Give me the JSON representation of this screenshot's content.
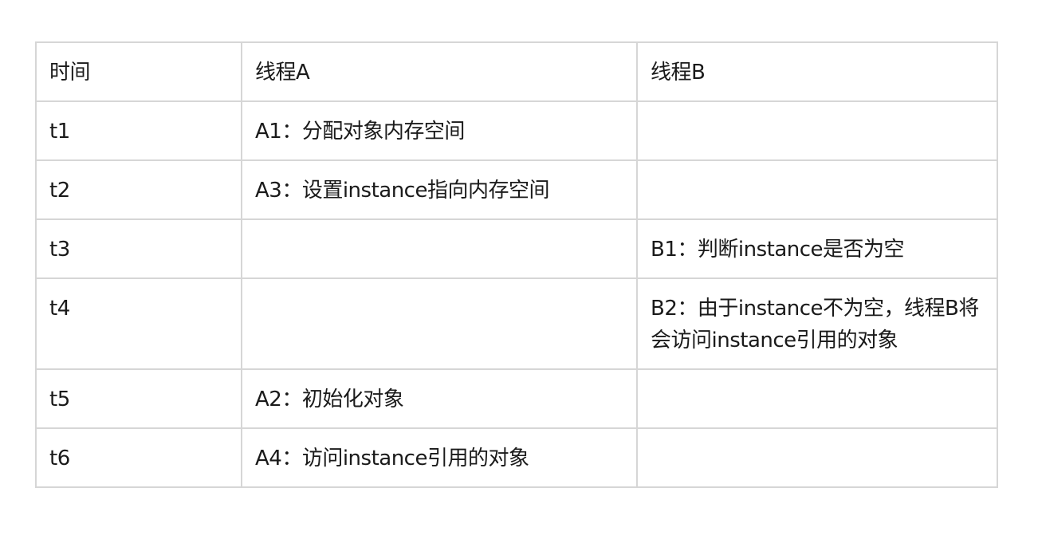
{
  "table": {
    "headers": [
      "时间",
      "线程A",
      "线程B"
    ],
    "rows": [
      {
        "time": "t1",
        "thread_a": "A1：分配对象内存空间",
        "thread_b": ""
      },
      {
        "time": "t2",
        "thread_a": "A3：设置instance指向内存空间",
        "thread_b": ""
      },
      {
        "time": "t3",
        "thread_a": "",
        "thread_b": "B1：判断instance是否为空"
      },
      {
        "time": "t4",
        "thread_a": "",
        "thread_b": "B2：由于instance不为空，线程B将会访问instance引用的对象"
      },
      {
        "time": "t5",
        "thread_a": "A2：初始化对象",
        "thread_b": ""
      },
      {
        "time": "t6",
        "thread_a": "A4：访问instance引用的对象",
        "thread_b": ""
      }
    ]
  },
  "colors": {
    "border": "#d6d6d6",
    "text": "#1a1a1a",
    "background": "#ffffff"
  }
}
